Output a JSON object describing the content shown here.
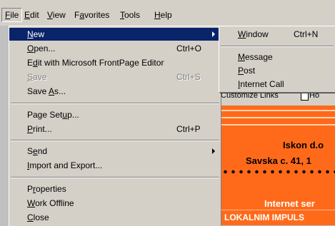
{
  "menubar": {
    "items": [
      {
        "pre": "",
        "ul": "F",
        "post": "ile"
      },
      {
        "pre": "",
        "ul": "E",
        "post": "dit"
      },
      {
        "pre": "",
        "ul": "V",
        "post": "iew"
      },
      {
        "pre": "F",
        "ul": "a",
        "post": "vorites"
      },
      {
        "pre": "",
        "ul": "T",
        "post": "ools"
      },
      {
        "pre": "",
        "ul": "H",
        "post": "elp"
      }
    ]
  },
  "file_menu": {
    "new": {
      "ul": "N",
      "post": "ew"
    },
    "open": {
      "ul": "O",
      "post": "pen...",
      "shortcut": "Ctrl+O"
    },
    "edit_frontpage": {
      "pre": "E",
      "ul": "d",
      "post": "it with Microsoft FrontPage Editor"
    },
    "save": {
      "ul": "S",
      "post": "ave",
      "shortcut": "Ctrl+S"
    },
    "save_as": {
      "pre": "Save ",
      "ul": "A",
      "post": "s..."
    },
    "page_setup": {
      "pre": "Page Set",
      "ul": "u",
      "post": "p..."
    },
    "print": {
      "ul": "P",
      "post": "rint...",
      "shortcut": "Ctrl+P"
    },
    "send": {
      "pre": "S",
      "ul": "e",
      "post": "nd"
    },
    "import_export": {
      "ul": "I",
      "post": "mport and Export..."
    },
    "properties": {
      "pre": "P",
      "ul": "r",
      "post": "operties"
    },
    "work_offline": {
      "ul": "W",
      "post": "ork Offline"
    },
    "close": {
      "ul": "C",
      "post": "lose"
    }
  },
  "new_submenu": {
    "window": {
      "ul": "W",
      "post": "indow",
      "shortcut": "Ctrl+N"
    },
    "message": {
      "ul": "M",
      "post": "essage"
    },
    "post": {
      "ul": "P",
      "post": "ost"
    },
    "internet_call": {
      "ul": "I",
      "post": "nternet Call"
    }
  },
  "links_bar": {
    "customize_links": "Customize Links",
    "second_link": "Ho"
  },
  "webpage": {
    "line1": "Iskon d.o",
    "line2": "Savska c. 41, 1",
    "line3": "Internet ser",
    "line4": "LOKALNIM IMPULS"
  },
  "colors": {
    "selection": "#0a246a",
    "menu_bg": "#d4d0c8",
    "web_orange": "#ff6a1a"
  }
}
